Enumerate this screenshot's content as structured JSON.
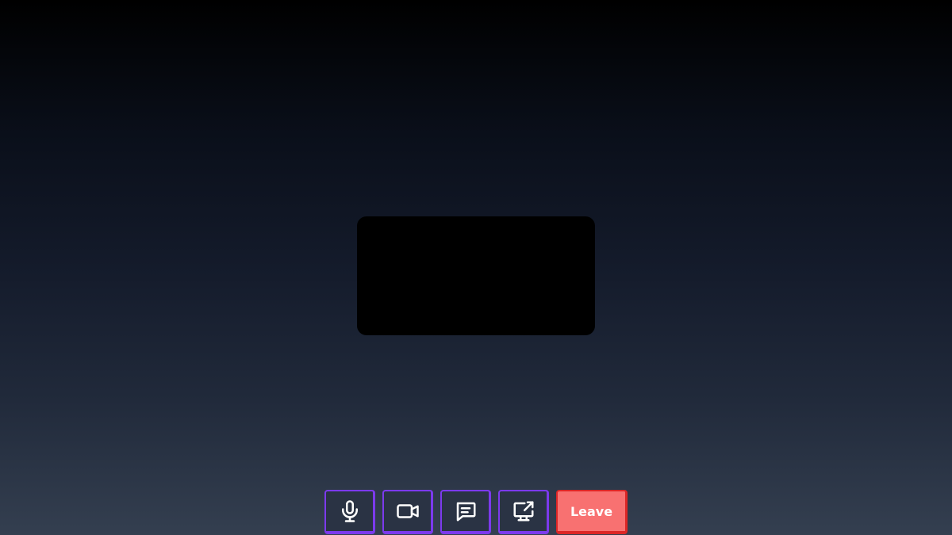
{
  "call": {
    "controls": {
      "microphone_icon": "microphone-icon",
      "camera_icon": "video-camera-icon",
      "chat_icon": "chat-icon",
      "screen_share_icon": "screen-share-icon",
      "leave_label": "Leave"
    }
  },
  "colors": {
    "button_bg": "#2a3344",
    "button_border": "#7c3aed",
    "leave_bg": "#f87171",
    "leave_border": "#dc2626",
    "video_tile_bg": "#000000"
  }
}
